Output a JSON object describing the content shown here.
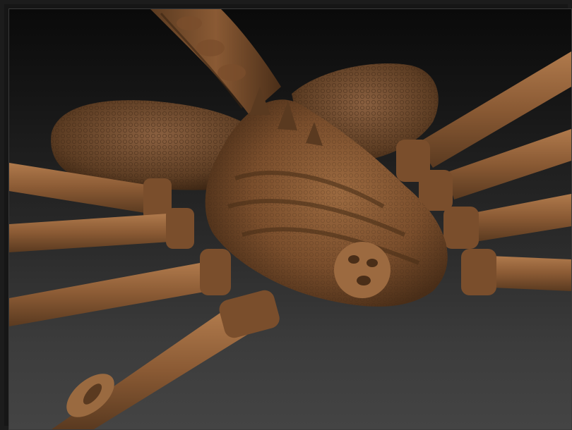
{
  "viewport": {
    "background_top": "#0a0a0a",
    "background_bottom": "#444444",
    "model": {
      "icon": "sculpt-model",
      "material_color": "#8a5a34",
      "shadow_color": "#4a2e18",
      "highlight_color": "#b07a4c"
    }
  }
}
